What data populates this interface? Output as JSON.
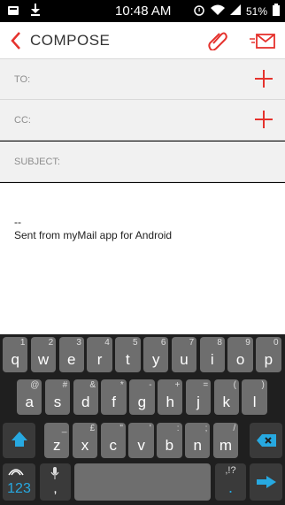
{
  "status_bar": {
    "time": "10:48 AM",
    "battery": "51%"
  },
  "header": {
    "title": "COMPOSE"
  },
  "fields": {
    "to_label": "TO:",
    "cc_label": "CC:",
    "subject_label": "SUBJECT:"
  },
  "message": {
    "signature_dash": "--",
    "signature_text": "Sent from myMail app for Android"
  },
  "keyboard": {
    "row1": [
      {
        "main": "q",
        "sup": "1"
      },
      {
        "main": "w",
        "sup": "2"
      },
      {
        "main": "e",
        "sup": "3"
      },
      {
        "main": "r",
        "sup": "4"
      },
      {
        "main": "t",
        "sup": "5"
      },
      {
        "main": "y",
        "sup": "6"
      },
      {
        "main": "u",
        "sup": "7"
      },
      {
        "main": "i",
        "sup": "8"
      },
      {
        "main": "o",
        "sup": "9"
      },
      {
        "main": "p",
        "sup": "0"
      }
    ],
    "row2": [
      {
        "main": "a",
        "sup": "@"
      },
      {
        "main": "s",
        "sup": "#"
      },
      {
        "main": "d",
        "sup": "&"
      },
      {
        "main": "f",
        "sup": "*"
      },
      {
        "main": "g",
        "sup": "-"
      },
      {
        "main": "h",
        "sup": "+"
      },
      {
        "main": "j",
        "sup": "="
      },
      {
        "main": "k",
        "sup": "("
      },
      {
        "main": "l",
        "sup": ")"
      }
    ],
    "row3": [
      {
        "main": "z",
        "sup": "_"
      },
      {
        "main": "x",
        "sup": "£"
      },
      {
        "main": "c",
        "sup": "\""
      },
      {
        "main": "v",
        "sup": "'"
      },
      {
        "main": "b",
        "sup": ":"
      },
      {
        "main": "n",
        "sup": ";"
      },
      {
        "main": "m",
        "sup": "/"
      }
    ],
    "numbers_label": "123",
    "punct_top": ",!?",
    "punct_main": "."
  },
  "colors": {
    "accent": "#e5322d",
    "keyboard_blue": "#27a9e1"
  }
}
